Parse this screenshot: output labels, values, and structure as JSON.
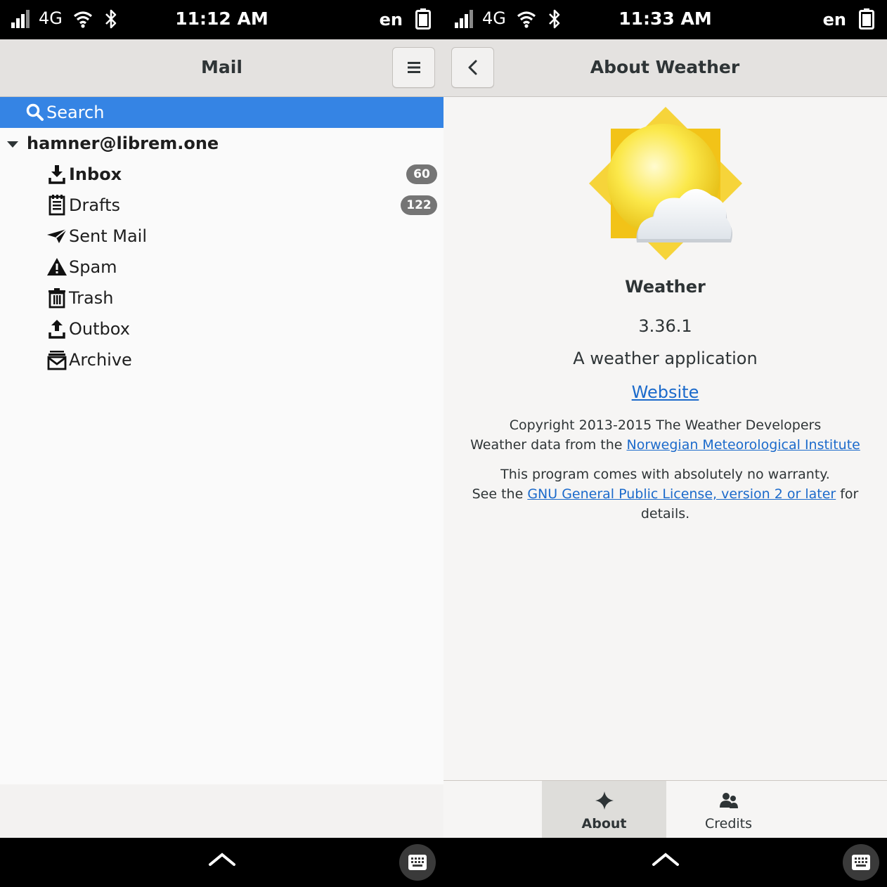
{
  "left": {
    "status": {
      "network": "4G",
      "time": "11:12 AM",
      "lang": "en"
    },
    "header": {
      "title": "Mail",
      "menu_icon": "hamburger-menu-icon"
    },
    "search": {
      "label": "Search",
      "icon": "search-icon"
    },
    "account": {
      "email": "hamner@librem.one"
    },
    "folders": [
      {
        "label": "Inbox",
        "icon": "inbox-icon",
        "badge": "60",
        "bold": true
      },
      {
        "label": "Drafts",
        "icon": "drafts-icon",
        "badge": "122"
      },
      {
        "label": "Sent Mail",
        "icon": "sent-icon"
      },
      {
        "label": "Spam",
        "icon": "warning-icon"
      },
      {
        "label": "Trash",
        "icon": "trash-icon"
      },
      {
        "label": "Outbox",
        "icon": "outbox-icon"
      },
      {
        "label": "Archive",
        "icon": "archive-icon"
      }
    ]
  },
  "right": {
    "status": {
      "network": "4G",
      "time": "11:33 AM",
      "lang": "en"
    },
    "header": {
      "title": "About Weather",
      "back_icon": "back-arrow-icon"
    },
    "about": {
      "name": "Weather",
      "version": "3.36.1",
      "description": "A weather application",
      "website": "Website",
      "copyright": "Copyright 2013-2015 The Weather Developers",
      "data_prefix": "Weather data from the ",
      "data_link": "Norwegian Meteorological Institute",
      "warranty_line1": "This program comes with absolutely no warranty.",
      "warranty_prefix": "See the ",
      "license_link": "GNU General Public License, version 2 or later",
      "warranty_suffix": " for details."
    },
    "tabs": [
      {
        "label": "About",
        "icon": "sparkle-icon",
        "active": true
      },
      {
        "label": "Credits",
        "icon": "people-icon",
        "active": false
      }
    ]
  },
  "colors": {
    "accent": "#3584e4",
    "link": "#1b6acb",
    "badge": "#757575"
  }
}
